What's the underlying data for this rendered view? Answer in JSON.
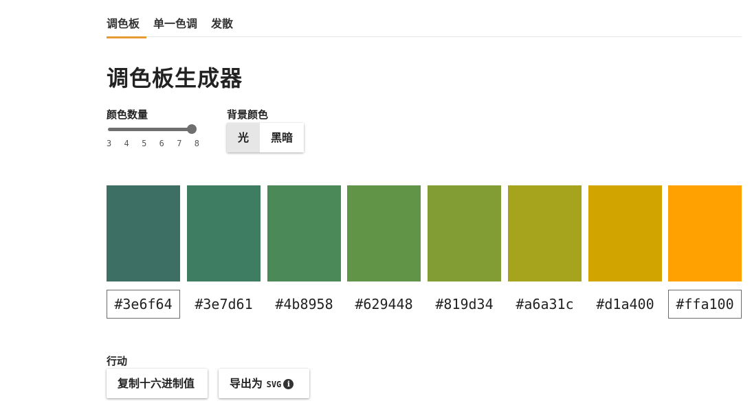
{
  "tabs": [
    {
      "label": "调色板",
      "active": true
    },
    {
      "label": "单一色调",
      "active": false
    },
    {
      "label": "发散",
      "active": false
    }
  ],
  "title": "调色板生成器",
  "controls": {
    "count_label": "颜色数量",
    "count_value": 8,
    "count_ticks": [
      "3",
      "4",
      "5",
      "6",
      "7",
      "8"
    ],
    "background_label": "背景颜色",
    "background_options": [
      "光",
      "黑暗"
    ],
    "background_selected": "光"
  },
  "palette": [
    {
      "color": "#3e6f64",
      "hex": "#3e6f64"
    },
    {
      "color": "#3e7d61",
      "hex": "#3e7d61"
    },
    {
      "color": "#4b8958",
      "hex": "#4b8958"
    },
    {
      "color": "#629448",
      "hex": "#629448"
    },
    {
      "color": "#819d34",
      "hex": "#819d34"
    },
    {
      "color": "#a6a31c",
      "hex": "#a6a31c"
    },
    {
      "color": "#d1a400",
      "hex": "#d1a400"
    },
    {
      "color": "#ffa100",
      "hex": "#ffa100"
    }
  ],
  "actions": {
    "label": "行动",
    "copy_label": "复制十六进制值",
    "export_label": "导出为",
    "export_format": "SVG",
    "info_icon": "info-icon"
  },
  "accent_color": "#e69a33"
}
